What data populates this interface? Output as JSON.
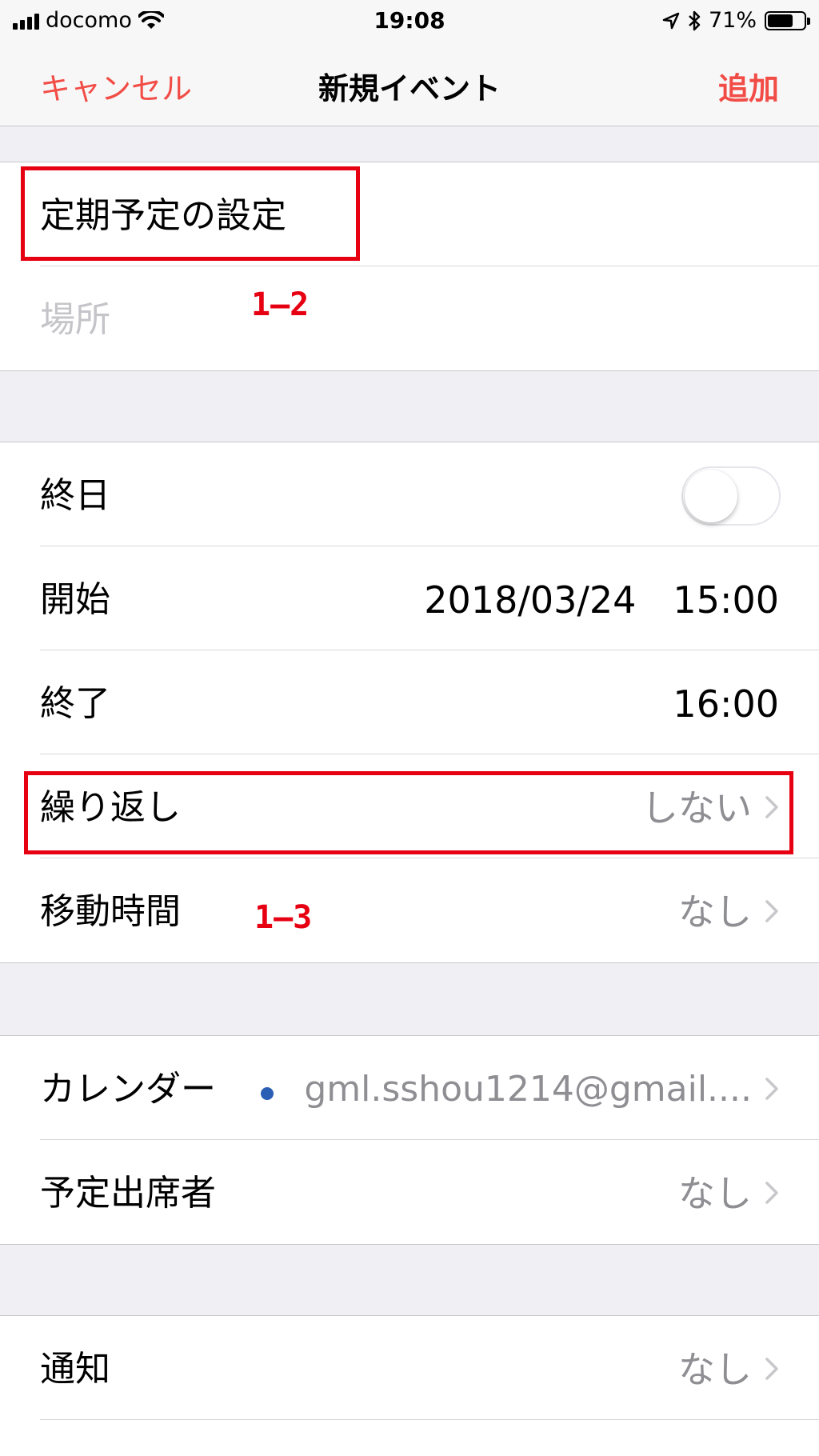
{
  "status_bar": {
    "carrier": "docomo",
    "time": "19:08",
    "battery_percent": "71%",
    "battery_level": 0.71
  },
  "nav": {
    "cancel_label": "キャンセル",
    "title": "新規イベント",
    "add_label": "追加"
  },
  "event": {
    "title_value": "定期予定の設定",
    "location_placeholder": "場所"
  },
  "schedule": {
    "all_day_label": "終日",
    "all_day_on": false,
    "start_label": "開始",
    "start_date": "2018/03/24",
    "start_time": "15:00",
    "end_label": "終了",
    "end_time": "16:00",
    "repeat_label": "繰り返し",
    "repeat_value": "しない",
    "travel_label": "移動時間",
    "travel_value": "なし"
  },
  "calendar": {
    "calendar_label": "カレンダー",
    "calendar_value": "gml.sshou1214@gmail....",
    "calendar_color": "#2a5fb5",
    "invitees_label": "予定出席者",
    "invitees_value": "なし"
  },
  "alerts": {
    "alert_label": "通知",
    "alert_value": "なし"
  },
  "annotations": {
    "label_1": "1–2",
    "label_2": "1–3"
  },
  "colors": {
    "accent": "#f24c46",
    "annotation": "#e60012"
  }
}
